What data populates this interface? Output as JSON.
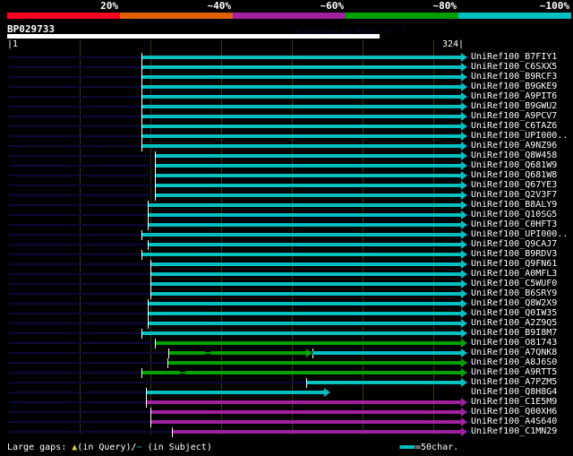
{
  "identity_scale": {
    "labels": [
      "20%",
      "~40%",
      "~60%",
      "~80%",
      "~100%"
    ],
    "colors": [
      "#ff0022",
      "#e06000",
      "#a020a0",
      "#00a000",
      "#00c0c0"
    ]
  },
  "query": {
    "title": "BP029733",
    "start": "|1",
    "end": "324|",
    "length": 324
  },
  "credit": "AlignView.pm Beta rel.7",
  "grid_interval": 50,
  "hits": [
    {
      "name": "UniRef100_B7FIY1",
      "start": 95,
      "end": 321,
      "identity": "~100%"
    },
    {
      "name": "UniRef100_C6SXX5",
      "start": 95,
      "end": 321,
      "identity": "~100%"
    },
    {
      "name": "UniRef100_B9RCF3",
      "start": 95,
      "end": 321,
      "identity": "~100%"
    },
    {
      "name": "UniRef100_B9GKE9",
      "start": 95,
      "end": 321,
      "identity": "~100%"
    },
    {
      "name": "UniRef100_A9PIT6",
      "start": 95,
      "end": 321,
      "identity": "~100%"
    },
    {
      "name": "UniRef100_B9GWU2",
      "start": 95,
      "end": 321,
      "identity": "~100%"
    },
    {
      "name": "UniRef100_A9PCV7",
      "start": 95,
      "end": 321,
      "identity": "~100%"
    },
    {
      "name": "UniRef100_C6TAZ6",
      "start": 95,
      "end": 321,
      "identity": "~100%"
    },
    {
      "name": "UniRef100_UPI000..",
      "start": 95,
      "end": 321,
      "identity": "~100%"
    },
    {
      "name": "UniRef100_A9NZ96",
      "start": 95,
      "end": 321,
      "identity": "~100%"
    },
    {
      "name": "UniRef100_Q8W458",
      "start": 104,
      "end": 321,
      "identity": "~100%"
    },
    {
      "name": "UniRef100_Q681W9",
      "start": 104,
      "end": 321,
      "identity": "~100%"
    },
    {
      "name": "UniRef100_Q681W8",
      "start": 104,
      "end": 321,
      "identity": "~100%"
    },
    {
      "name": "UniRef100_Q67YE3",
      "start": 104,
      "end": 321,
      "identity": "~100%"
    },
    {
      "name": "UniRef100_Q2V3F7",
      "start": 104,
      "end": 321,
      "identity": "~100%"
    },
    {
      "name": "UniRef100_B8ALY9",
      "start": 99,
      "end": 321,
      "identity": "~100%"
    },
    {
      "name": "UniRef100_Q10SG5",
      "start": 99,
      "end": 321,
      "identity": "~100%"
    },
    {
      "name": "UniRef100_C0HFT3",
      "start": 99,
      "end": 321,
      "identity": "~100%"
    },
    {
      "name": "UniRef100_UPI000..",
      "start": 95,
      "end": 321,
      "identity": "~100%"
    },
    {
      "name": "UniRef100_Q9CAJ7",
      "start": 99,
      "end": 321,
      "identity": "~100%"
    },
    {
      "name": "UniRef100_B9RDV3",
      "start": 95,
      "end": 321,
      "identity": "~100%"
    },
    {
      "name": "UniRef100_Q9FN61",
      "start": 101,
      "end": 321,
      "identity": "~100%"
    },
    {
      "name": "UniRef100_A0MFL3",
      "start": 101,
      "end": 321,
      "identity": "~100%"
    },
    {
      "name": "UniRef100_C5WUF0",
      "start": 101,
      "end": 321,
      "identity": "~100%"
    },
    {
      "name": "UniRef100_B6SRY9",
      "start": 101,
      "end": 321,
      "identity": "~100%"
    },
    {
      "name": "UniRef100_Q8W2X9",
      "start": 99,
      "end": 321,
      "identity": "~100%"
    },
    {
      "name": "UniRef100_Q0IW35",
      "start": 99,
      "end": 321,
      "identity": "~100%"
    },
    {
      "name": "UniRef100_A2Z9Q5",
      "start": 99,
      "end": 321,
      "identity": "~100%"
    },
    {
      "name": "UniRef100_B9I8M7",
      "start": 95,
      "end": 321,
      "identity": "~100%"
    },
    {
      "name": "UniRef100_O81743",
      "start": 104,
      "end": 321,
      "identity": "~80%"
    },
    {
      "name": "UniRef100_A7QNK8",
      "start": 114,
      "end": 321,
      "identity": "~80%",
      "split": 215,
      "split_identity": "~100%",
      "gaps": [
        140
      ]
    },
    {
      "name": "UniRef100_A8J6S0",
      "start": 113,
      "end": 321,
      "identity": "~80%"
    },
    {
      "name": "UniRef100_A9RTT5",
      "start": 95,
      "end": 321,
      "identity": "~80%",
      "gaps": [
        122
      ]
    },
    {
      "name": "UniRef100_A7PZM5",
      "start": 211,
      "end": 321,
      "identity": "~100%"
    },
    {
      "name": "UniRef100_Q8H8G4",
      "start": 98,
      "end": 224,
      "identity": "~100%"
    },
    {
      "name": "UniRef100_C1E5M9",
      "start": 98,
      "end": 321,
      "identity": "~60%"
    },
    {
      "name": "UniRef100_Q00XH6",
      "start": 101,
      "end": 321,
      "identity": "~60%"
    },
    {
      "name": "UniRef100_A4S640",
      "start": 101,
      "end": 321,
      "identity": "~60%"
    },
    {
      "name": "UniRef100_C1MN29",
      "start": 116,
      "end": 321,
      "identity": "~60%"
    }
  ],
  "footer": {
    "gaps_label": "Large gaps:",
    "query_gap_icon": "yellow-triangle-icon",
    "query_gap_text": "(in Query)/",
    "subject_gap_text": "(in Subject)",
    "scale_text": "=50char."
  }
}
